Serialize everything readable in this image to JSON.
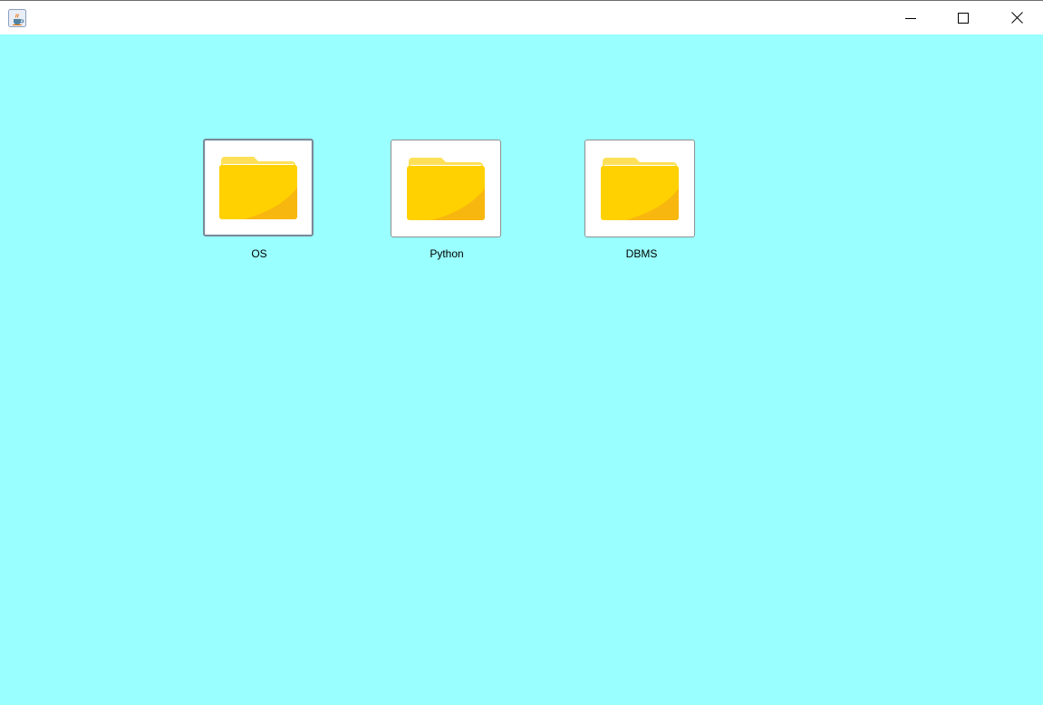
{
  "window": {
    "app_icon": "java-coffee-icon",
    "controls": {
      "minimize_icon": "minimize-icon",
      "maximize_icon": "maximize-icon",
      "close_icon": "close-icon"
    }
  },
  "client": {
    "background_color": "#99ffff",
    "folders": [
      {
        "label": "OS",
        "icon": "folder-icon",
        "focused": true
      },
      {
        "label": "Python",
        "icon": "folder-icon",
        "focused": false
      },
      {
        "label": "DBMS",
        "icon": "folder-icon",
        "focused": false
      }
    ]
  },
  "colors": {
    "folder_front": "#ffd100",
    "folder_back": "#fde058",
    "folder_shadow": "#f8b70f",
    "paper": "#ffffff"
  }
}
